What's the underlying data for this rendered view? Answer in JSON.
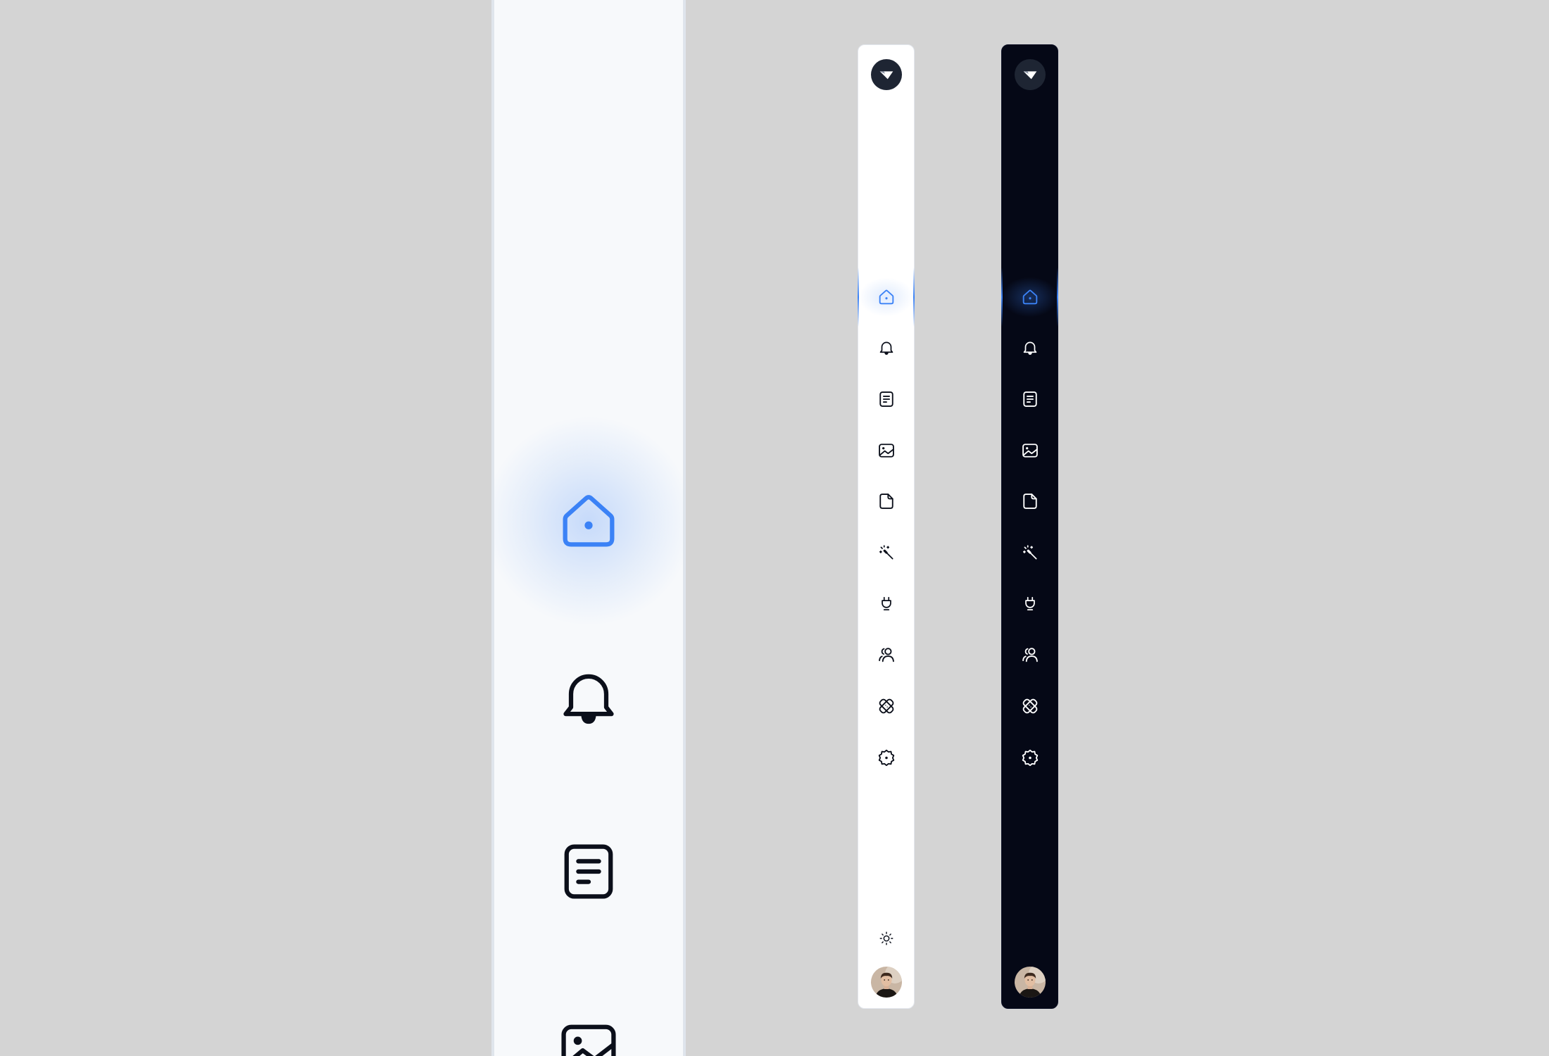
{
  "colors": {
    "background": "#d4d4d4",
    "accent": "#3b82f6",
    "light_sidebar": "#ffffff",
    "dark_sidebar": "#050816",
    "icon_light": "#0b0f1a",
    "icon_dark": "#ffffff"
  },
  "zoom_panel": {
    "icons": [
      "home-icon",
      "bell-icon",
      "document-icon",
      "image-icon"
    ],
    "active": "home-icon"
  },
  "sidebar_light": {
    "theme": "light",
    "logo": "logo-icon",
    "nav_items": [
      "home-icon",
      "bell-icon",
      "document-icon",
      "image-icon",
      "file-icon",
      "magic-wand-icon",
      "plug-icon",
      "users-icon",
      "bandage-icon",
      "settings-icon"
    ],
    "active_item": "home-icon",
    "theme_toggle": "sun-icon",
    "avatar": "avatar"
  },
  "sidebar_dark": {
    "theme": "dark",
    "logo": "logo-icon",
    "nav_items": [
      "home-icon",
      "bell-icon",
      "document-icon",
      "image-icon",
      "file-icon",
      "magic-wand-icon",
      "plug-icon",
      "users-icon",
      "bandage-icon",
      "settings-icon"
    ],
    "active_item": "home-icon",
    "avatar": "avatar"
  }
}
